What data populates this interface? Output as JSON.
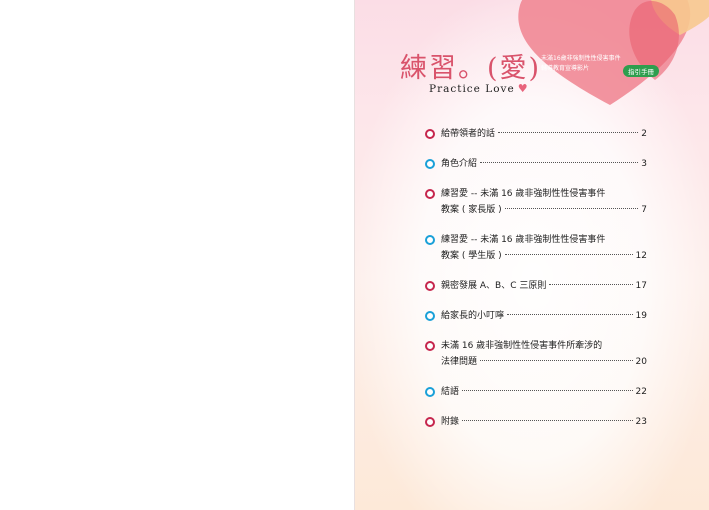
{
  "title": "練習。(愛)",
  "subtitle_en": "Practice Love",
  "banner": {
    "line1": "未滿16歲非強制性性侵害事件",
    "line2": "輔導教育宣導影片",
    "badge": "指引手冊"
  },
  "toc": [
    {
      "lines": [
        "給帶領者的話"
      ],
      "page": "2",
      "bullet": "red"
    },
    {
      "lines": [
        "角色介紹"
      ],
      "page": "3",
      "bullet": "blue"
    },
    {
      "lines": [
        "練習愛 -- 未滿 16 歲非強制性性侵害事件",
        "教案 ( 家長版 )"
      ],
      "page": "7",
      "bullet": "red"
    },
    {
      "lines": [
        "練習愛 -- 未滿 16 歲非強制性性侵害事件",
        "教案 ( 學生版 )"
      ],
      "page": "12",
      "bullet": "blue"
    },
    {
      "lines": [
        "親密發展 A、B、C 三原則"
      ],
      "page": "17",
      "bullet": "red"
    },
    {
      "lines": [
        "給家長的小叮嚀"
      ],
      "page": "19",
      "bullet": "blue"
    },
    {
      "lines": [
        "未滿 16 歲非強制性性侵害事件所牽涉的",
        "法律問題"
      ],
      "page": "20",
      "bullet": "red"
    },
    {
      "lines": [
        "結語"
      ],
      "page": "22",
      "bullet": "blue"
    },
    {
      "lines": [
        "附錄"
      ],
      "page": "23",
      "bullet": "red"
    }
  ],
  "colors": {
    "title": "#d9536b",
    "bullet_red": "#c6264d",
    "bullet_blue": "#1aa0d8",
    "badge": "#2e9e4e"
  }
}
